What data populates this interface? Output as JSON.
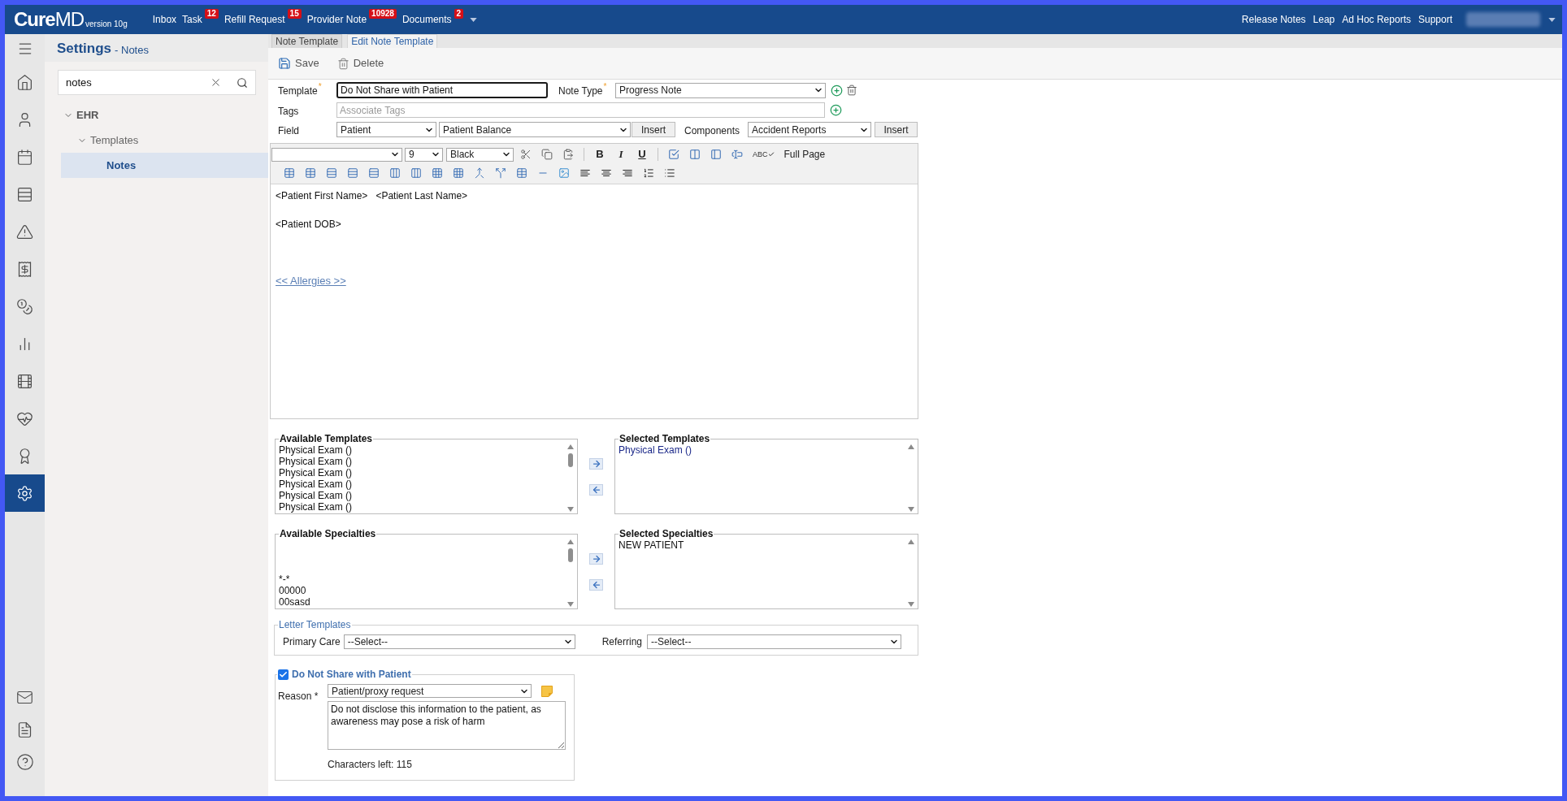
{
  "top_bar": {
    "logo": {
      "strong": "Cure",
      "light": "MD",
      "version": "version 10g"
    },
    "nav": [
      {
        "label": "Inbox"
      },
      {
        "label": "Task",
        "badge": "12"
      },
      {
        "label": "Refill Request",
        "badge": "15"
      },
      {
        "label": "Provider Note",
        "badge": "10928"
      },
      {
        "label": "Documents",
        "badge": "2"
      }
    ],
    "links": [
      "Release Notes",
      "Leap",
      "Ad Hoc Reports",
      "Support"
    ]
  },
  "icon_rail": {
    "items": [
      {
        "selected": false
      },
      {
        "selected": false
      },
      {
        "selected": false
      },
      {
        "selected": false
      },
      {
        "selected": false
      },
      {
        "selected": false
      },
      {
        "selected": false
      },
      {
        "selected": false
      },
      {
        "selected": false
      },
      {
        "selected": false
      },
      {
        "selected": false
      },
      {
        "selected": true
      }
    ]
  },
  "settings_panel": {
    "title": "Settings",
    "subtitle": "- Notes",
    "search": {
      "value": "notes"
    },
    "tree": [
      {
        "label": "EHR",
        "expanded": true,
        "selected": false,
        "children": [
          {
            "label": "Templates",
            "expanded": true,
            "selected": false,
            "children": [
              {
                "label": "Notes",
                "selected": true
              }
            ]
          }
        ]
      }
    ]
  },
  "tabs": [
    {
      "label": "Note Template",
      "selected": false
    },
    {
      "label": "Edit Note Template",
      "selected": true
    }
  ],
  "toolbar": {
    "actions": [
      {
        "label": "Save"
      },
      {
        "label": "Delete"
      }
    ]
  },
  "form": {
    "template": {
      "label": "Template",
      "required_mark": "*",
      "value": "Do Not Share with Patient",
      "focused": true
    },
    "note_type": {
      "label": "Note Type",
      "required_mark": "*",
      "value": "Progress Note"
    },
    "tags": {
      "label": "Tags",
      "placeholder": "Associate Tags"
    },
    "field": {
      "label": "Field",
      "category": "Patient",
      "value": "Patient Balance",
      "button": "Insert"
    },
    "components": {
      "label": "Components",
      "value": "Accident Reports",
      "button": "Insert"
    }
  },
  "editor": {
    "size": "9",
    "font_color": "Black",
    "format_buttons": [
      {
        "kind": "bold",
        "label": "B"
      },
      {
        "kind": "italic",
        "label": "I"
      },
      {
        "kind": "underline",
        "label": "U"
      }
    ],
    "spellcheck_label": "ABC",
    "full_page": "Full Page",
    "lines": [
      "<Patient First Name>   <Patient Last Name>",
      "<Patient DOB>"
    ],
    "link": "<< Allergies >>"
  },
  "lists": {
    "available_templates": {
      "title": "Available Templates",
      "items": [
        "Physical Exam ()",
        "Physical Exam ()",
        "Physical Exam ()",
        "Physical Exam ()",
        "Physical Exam ()",
        "Physical Exam ()"
      ]
    },
    "selected_templates": {
      "title": "Selected Templates",
      "items": [
        "Physical Exam ()"
      ]
    },
    "available_specialties": {
      "title": "Available Specialties",
      "items": [
        "*-*",
        "00000",
        "00sasd"
      ]
    },
    "selected_specialties": {
      "title": "Selected Specialties",
      "items": [
        "NEW PATIENT"
      ]
    }
  },
  "letter_templates": {
    "title": "Letter Templates",
    "primary_care": {
      "label": "Primary Care",
      "value": "--Select--"
    },
    "referring": {
      "label": "Referring",
      "value": "--Select--"
    }
  },
  "privacy": {
    "checked": true,
    "label": "Do Not Share with Patient",
    "reason_label": "Reason *",
    "reason": "Patient/proxy request",
    "note": "Do not disclose this information to the patient, as awareness may pose a risk of harm",
    "characters_left": "Characters left: 115"
  }
}
